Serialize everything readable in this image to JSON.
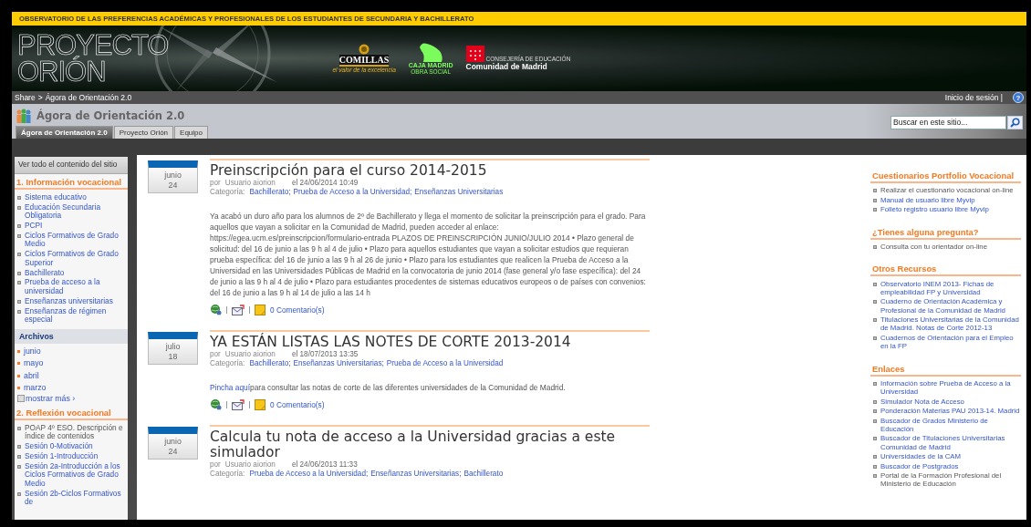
{
  "header_bar": {
    "text": "OBSERVATORIO DE LAS PREFERENCIAS ACADÉMICAS Y PROFESIONALES DE LOS ESTUDIANTES DE SECUNDARIA Y BACHILLERATO"
  },
  "banner": {
    "title_lines": [
      "PROYECTO",
      "ORIÓN"
    ],
    "logos": [
      {
        "kind": "comillas",
        "name": "COMILLAS",
        "tagline": "el valor de la excelencia"
      },
      {
        "kind": "caja",
        "name": "CAJA MADRID",
        "tagline": "OBRA SOCIAL"
      },
      {
        "kind": "comunidad",
        "name": "Comunidad de Madrid",
        "tagline": "CONSEJERÍA DE EDUCACIÓN"
      }
    ]
  },
  "breadcrumb": {
    "items": [
      "Share",
      "Ágora de Orientación 2.0"
    ],
    "separator": ">",
    "login": "Inicio de sesión |",
    "help": "?"
  },
  "site": {
    "title": "Ágora de Orientación 2.0"
  },
  "tabs": [
    {
      "label": "Ágora de Orientación 2.0",
      "selected": true
    },
    {
      "label": "Proyecto Orión",
      "selected": false
    },
    {
      "label": "Equipo",
      "selected": false
    }
  ],
  "search": {
    "placeholder": "Buscar en este sitio..."
  },
  "left_nav": {
    "view_all": "Ver todo el contenido del sitio",
    "sections": [
      {
        "kind": "links",
        "heading": "1. Información vocacional",
        "items": [
          {
            "label": "Sistema educativo",
            "link": true
          },
          {
            "label": "Educación Secundaria Obligatoria",
            "link": true
          },
          {
            "label": "PCPI",
            "link": true
          },
          {
            "label": "Ciclos Formativos de Grado Medio",
            "link": true
          },
          {
            "label": "Ciclos Formativos de Grado Superior",
            "link": true
          },
          {
            "label": "Bachillerato",
            "link": true
          },
          {
            "label": "Prueba de acceso a la universidad",
            "link": true
          },
          {
            "label": "Enseñanzas universitarias",
            "link": true
          },
          {
            "label": "Enseñanzas de régimen especial",
            "link": true
          }
        ]
      },
      {
        "kind": "archive",
        "heading": "Archivos",
        "items": [
          {
            "label": "junio",
            "link": true
          },
          {
            "label": "mayo",
            "link": true
          },
          {
            "label": "abril",
            "link": true
          },
          {
            "label": "marzo",
            "link": true
          }
        ],
        "more": "mostrar más ›"
      },
      {
        "kind": "links",
        "heading": "2. Reflexión vocacional",
        "items": [
          {
            "label": "POAP 4º ESO. Descripción e índice de contenidos",
            "link": false
          },
          {
            "label": "Sesión 0-Motivación",
            "link": true
          },
          {
            "label": "Sesión 1-Introducción",
            "link": true
          },
          {
            "label": "Sesión 2a-Introducción a los Ciclos Formativos de Grado Medio",
            "link": true
          },
          {
            "label": "Sesión 2b-Ciclos Formativos de",
            "link": true
          }
        ]
      }
    ]
  },
  "posts": [
    {
      "month": "junio",
      "day": "24",
      "title": "Preinscripción para el curso 2014-2015",
      "author_prefix": "por",
      "author": "Usuario aiorion",
      "date": "el 24/06/2014 10:49",
      "category_label": "Categoría:",
      "categories": [
        "Bachillerato;",
        "Prueba de Acceso a la Universidad;",
        "Enseñanzas Universitarias"
      ],
      "body": "Ya acabó un duro año para los alumnos de 2º de Bachillerato y llega el momento de solicitar la preinscripción para el grado. Para aquellos que vayan a solicitar en la Comunidad de Madrid, pueden acceder al enlace: https://egea.ucm.es/preinscripcion/formulario-entrada PLAZOS DE PREINSCRIPCIÓN JUNIO/JULIO 2014 • Plazo general de solicitud: del 16 de junio a las 9 h al 4 de julio • Plazo para aquellos estudiantes que vayan a solicitar estudios que requieran prueba específica: del 16 de junio a las 9 h al 26 de junio • Plazo para los estudiantes que realicen la Prueba de Acceso a la Universidad en las Universidades Públicas de Madrid en la convocatoria de junio 2014 (fase general y/o fase específica): del 24 de junio a las 9 h al 4 de julio • Plazo para estudiantes procedentes de sistemas educativos europeos o de países con convenios: del 16 de junio a las 9 h al 14 de julio a las 14 h",
      "comments": "0 Comentario(s)"
    },
    {
      "month": "julio",
      "day": "18",
      "title": "YA ESTÁN LISTAS LAS NOTES DE CORTE 2013-2014",
      "author_prefix": "por",
      "author": "Usuario aiorion",
      "date": "el 18/07/2013 13:35",
      "category_label": "Categoría:",
      "categories": [
        "Bachillerato;",
        "Enseñanzas Universitarias;",
        "Prueba de Acceso a la Universidad"
      ],
      "body_link": "Pincha aquí",
      "body": "para consultar las notas de corte de las diferentes universidades de la Comunidad de Madrid.",
      "comments": "0 Comentario(s)"
    },
    {
      "month": "junio",
      "day": "24",
      "title": "Calcula tu nota de acceso a la Universidad gracias a este simulador",
      "author_prefix": "por",
      "author": "Usuario aiorion",
      "date": "el 24/06/2013 11:33",
      "category_label": "Categoría:",
      "categories": [
        "Prueba de Acceso a la Universidad;",
        "Enseñanzas Universitarias;",
        "Bachillerato"
      ]
    }
  ],
  "right_sections": [
    {
      "heading": "Cuestionarios Portfolio Vocacional",
      "items": [
        {
          "label": "Realizar el cuestionario vocacional on-line",
          "link": false
        },
        {
          "label": "Manual de usuario libre Myvip",
          "link": true
        },
        {
          "label": "Folleto registro usuario libre Myvip",
          "link": true
        }
      ]
    },
    {
      "heading": "¿Tienes alguna pregunta?",
      "items": [
        {
          "label": "Consulta con tu orientador on-line",
          "link": false
        }
      ]
    },
    {
      "heading": "Otros Recursos",
      "items": [
        {
          "label": "Observatorio INEM 2013- Fichas de empleabilidad FP y Universidad",
          "link": true
        },
        {
          "label": "Cuaderno de Orientación Académica y Profesional de la Comunidad de Madrid",
          "link": true
        },
        {
          "label": "Titulaciones Universitarias de la Comunidad de Madrid. Notas de Corte 2012-13",
          "link": true
        },
        {
          "label": "Cuadernos de Orientación para el Empleo en la FP",
          "link": true
        }
      ]
    },
    {
      "heading": "Enlaces",
      "items": [
        {
          "label": "Información sobre Prueba de Acceso a la Universidad",
          "link": true
        },
        {
          "label": "Simulador Nota de Acceso",
          "link": true
        },
        {
          "label": "Ponderación Materias PAU 2013-14. Madrid",
          "link": true
        },
        {
          "label": "Buscador de Grados Ministerio de Educación",
          "link": true
        },
        {
          "label": "Buscador de Titulaciones Universitarias Comunidad de Madrid",
          "link": true
        },
        {
          "label": "Universidades de la CAM",
          "link": true
        },
        {
          "label": "Buscador de Postgrados",
          "link": true
        },
        {
          "label": "Portal de la Formación Profesional del Ministerio de Educación",
          "link": false
        }
      ]
    }
  ]
}
